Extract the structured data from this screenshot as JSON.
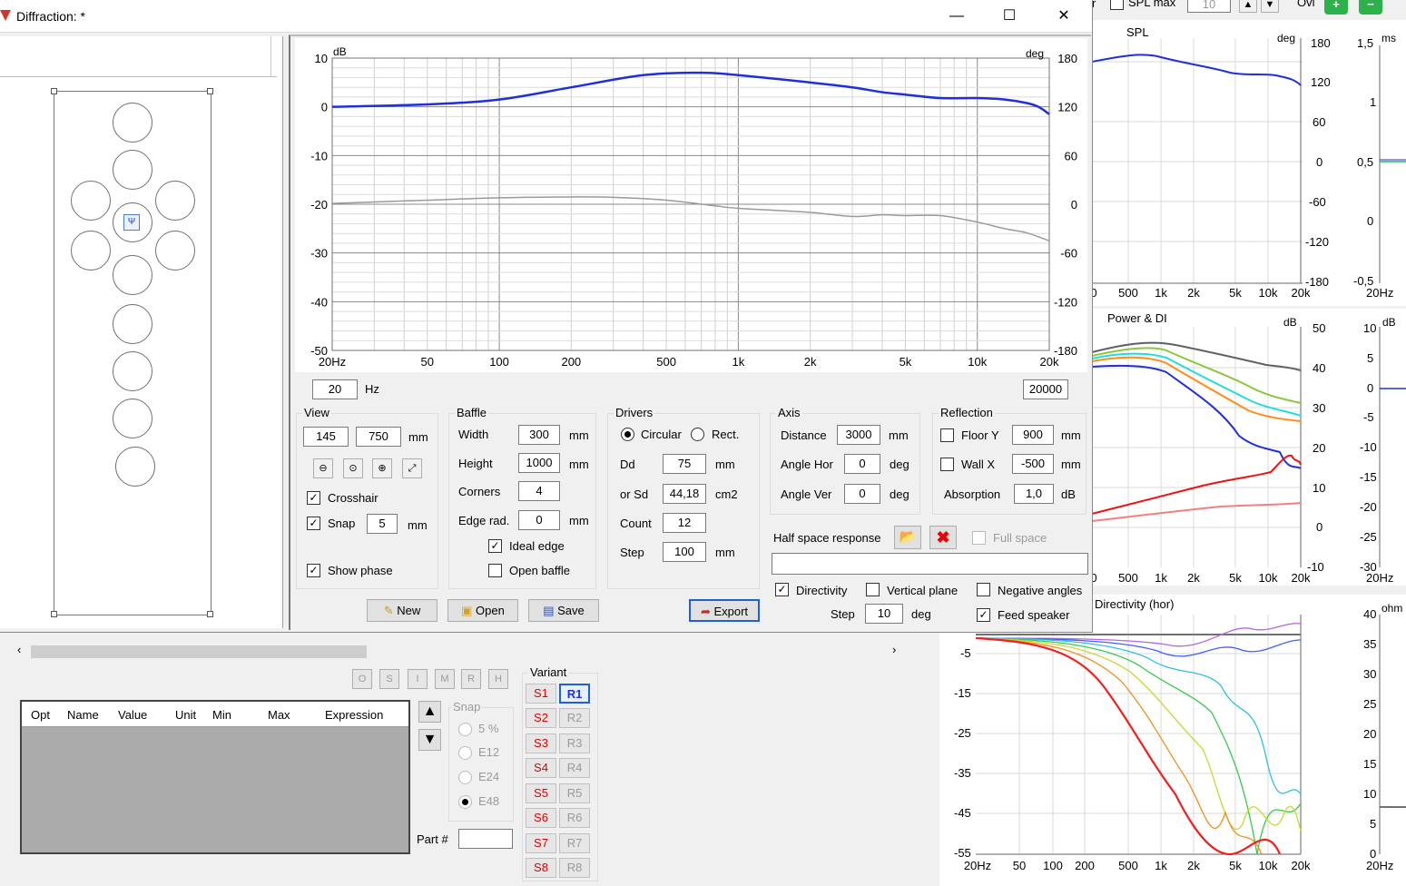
{
  "window": {
    "title": "Diffraction: *"
  },
  "bg_toolbar": {
    "spl_max_label": "SPL max",
    "spl_max_value": "10",
    "ovl_label": "Ovl"
  },
  "main_chart": {
    "y_left_unit": "dB",
    "y_right_unit": "deg",
    "y_left_ticks": [
      "10",
      "0",
      "-10",
      "-20",
      "-30",
      "-40",
      "-50"
    ],
    "y_right_ticks": [
      "180",
      "120",
      "60",
      "0",
      "-60",
      "-120",
      "-180"
    ],
    "x_ticks": [
      "20Hz",
      "50",
      "100",
      "200",
      "500",
      "1k",
      "2k",
      "5k",
      "10k",
      "20k"
    ]
  },
  "chart_data": {
    "type": "line",
    "x_scale": "log",
    "xlim": [
      20,
      20000
    ],
    "ylim": [
      -50,
      10
    ],
    "y2lim": [
      -180,
      180
    ],
    "series": [
      {
        "color": "#1f30d8",
        "axis": "left",
        "x": [
          20,
          50,
          100,
          200,
          400,
          700,
          1000,
          2000,
          3000,
          4000,
          5000,
          7000,
          10000,
          13000,
          16000,
          18000,
          20000
        ],
        "y": [
          0,
          0.5,
          1.5,
          4,
          6.5,
          7,
          6.5,
          5,
          4,
          3,
          2.5,
          1.8,
          1.8,
          1.5,
          0.8,
          0,
          -1.5
        ]
      },
      {
        "color": "#9a9a9a",
        "axis": "right",
        "x": [
          20,
          50,
          100,
          200,
          300,
          500,
          800,
          1000,
          2000,
          3000,
          4000,
          5000,
          7000,
          10000,
          13000,
          16000,
          20000
        ],
        "y": [
          1,
          5,
          8,
          9,
          8.5,
          5,
          -2,
          -5,
          -10,
          -15,
          -13,
          -14,
          -14,
          -22,
          -30,
          -35,
          -45
        ]
      }
    ]
  },
  "freq_range": {
    "min": "20",
    "unit": "Hz",
    "max": "20000"
  },
  "view": {
    "title": "View",
    "x": "145",
    "y": "750",
    "unit": "mm",
    "crosshair": "Crosshair",
    "snap": "Snap",
    "snap_value": "5",
    "snap_unit": "mm",
    "show_phase": "Show phase"
  },
  "baffle": {
    "title": "Baffle",
    "width_label": "Width",
    "width": "300",
    "height_label": "Height",
    "height": "1000",
    "corners_label": "Corners",
    "corners": "4",
    "edge_label": "Edge rad.",
    "edge": "0",
    "unit": "mm",
    "ideal_edge": "Ideal edge",
    "open_baffle": "Open baffle"
  },
  "drivers": {
    "title": "Drivers",
    "circular": "Circular",
    "rect": "Rect.",
    "dd_label": "Dd",
    "dd": "75",
    "dd_unit": "mm",
    "sd_label": "or Sd",
    "sd": "44,18",
    "sd_unit": "cm2",
    "count_label": "Count",
    "count": "12",
    "step_label": "Step",
    "step": "100",
    "step_unit": "mm"
  },
  "axis": {
    "title": "Axis",
    "distance_label": "Distance",
    "distance": "3000",
    "distance_unit": "mm",
    "hor_label": "Angle Hor",
    "hor": "0",
    "ver_label": "Angle Ver",
    "ver": "0",
    "deg": "deg"
  },
  "reflection": {
    "title": "Reflection",
    "floor": "Floor Y",
    "floor_value": "900",
    "wall": "Wall  X",
    "wall_value": "-500",
    "unit": "mm",
    "absorption_label": "Absorption",
    "absorption": "1,0",
    "absorption_unit": "dB"
  },
  "half_space": {
    "label": "Half space response",
    "full_space": "Full space"
  },
  "directivity_opts": {
    "directivity": "Directivity",
    "vertical": "Vertical plane",
    "negative": "Negative angles",
    "step_label": "Step",
    "step": "10",
    "step_unit": "deg",
    "feed": "Feed speaker"
  },
  "buttons": {
    "new": "New",
    "open": "Open",
    "save": "Save",
    "export": "Export"
  },
  "right_charts": {
    "spl_title": "SPL",
    "spl_deg": "deg",
    "spl_ticks": [
      "180",
      "120",
      "60",
      "0",
      "-60",
      "-120",
      "-180"
    ],
    "x_ticks": [
      "500",
      "1k",
      "2k",
      "5k",
      "10k",
      "20k"
    ],
    "ms_unit": "ms",
    "ms_ticks": [
      "1,5",
      "1",
      "0,5",
      "0",
      "-0,5"
    ],
    "power_title": "Power & DI",
    "power_unit": "dB",
    "power_ticks": [
      "50",
      "40",
      "30",
      "20",
      "10",
      "0",
      "-10"
    ],
    "db_ticks": [
      "10",
      "5",
      "0",
      "-5",
      "-10",
      "-15",
      "-20",
      "-25",
      "-30"
    ],
    "db_unit": "dB",
    "dir_title": "Directivity (hor)",
    "dir_ticks": [
      "-5",
      "-15",
      "-25",
      "-35",
      "-45",
      "-55"
    ],
    "dir_x_ticks": [
      "20Hz",
      "50",
      "100",
      "200",
      "500",
      "1k",
      "2k",
      "5k",
      "10k",
      "20k"
    ],
    "ohm_unit": "ohm",
    "ohm_ticks": [
      "40",
      "35",
      "30",
      "25",
      "20",
      "15",
      "10",
      "5",
      "0"
    ],
    "hz20": "20Hz"
  },
  "param_table": {
    "cols": [
      "Opt",
      "Name",
      "Value",
      "Unit",
      "Min",
      "Max",
      "Expression"
    ],
    "tool_letters": [
      "O",
      "S",
      "I",
      "M",
      "R",
      "H"
    ],
    "snap_title": "Snap",
    "snap_opts": [
      "5 %",
      "E12",
      "E24",
      "E48"
    ],
    "part_label": "Part #"
  },
  "variant": {
    "title": "Variant",
    "s": [
      "S1",
      "S2",
      "S3",
      "S4",
      "S5",
      "S6",
      "S7",
      "S8"
    ],
    "r": [
      "R1",
      "R2",
      "R3",
      "R4",
      "R5",
      "R6",
      "R7",
      "R8"
    ]
  }
}
